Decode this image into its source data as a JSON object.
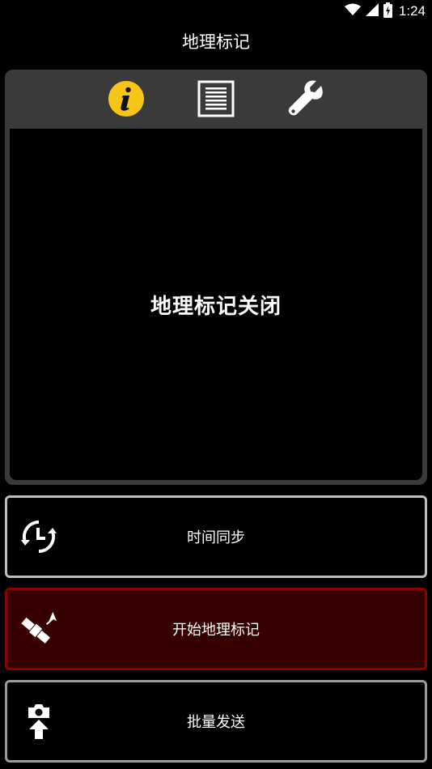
{
  "status_bar": {
    "time": "1:24",
    "icons": [
      "wifi-icon",
      "cell-signal-icon",
      "battery-charging-icon"
    ]
  },
  "app": {
    "title": "地理标记"
  },
  "tabs": [
    {
      "name": "info",
      "icon": "info-icon",
      "active": true,
      "color": "#f5c518"
    },
    {
      "name": "log",
      "icon": "document-list-icon",
      "active": false
    },
    {
      "name": "settings",
      "icon": "wrench-icon",
      "active": false
    }
  ],
  "panel": {
    "status_text": "地理标记关闭"
  },
  "buttons": {
    "sync_label": "时间同步",
    "start_label": "开始地理标记",
    "batch_label": "批量发送"
  },
  "colors": {
    "background": "#000000",
    "panel": "#3a3a3a",
    "start_button_bg": "#360000",
    "start_button_border": "#8b0000",
    "info_accent": "#f5c518"
  }
}
